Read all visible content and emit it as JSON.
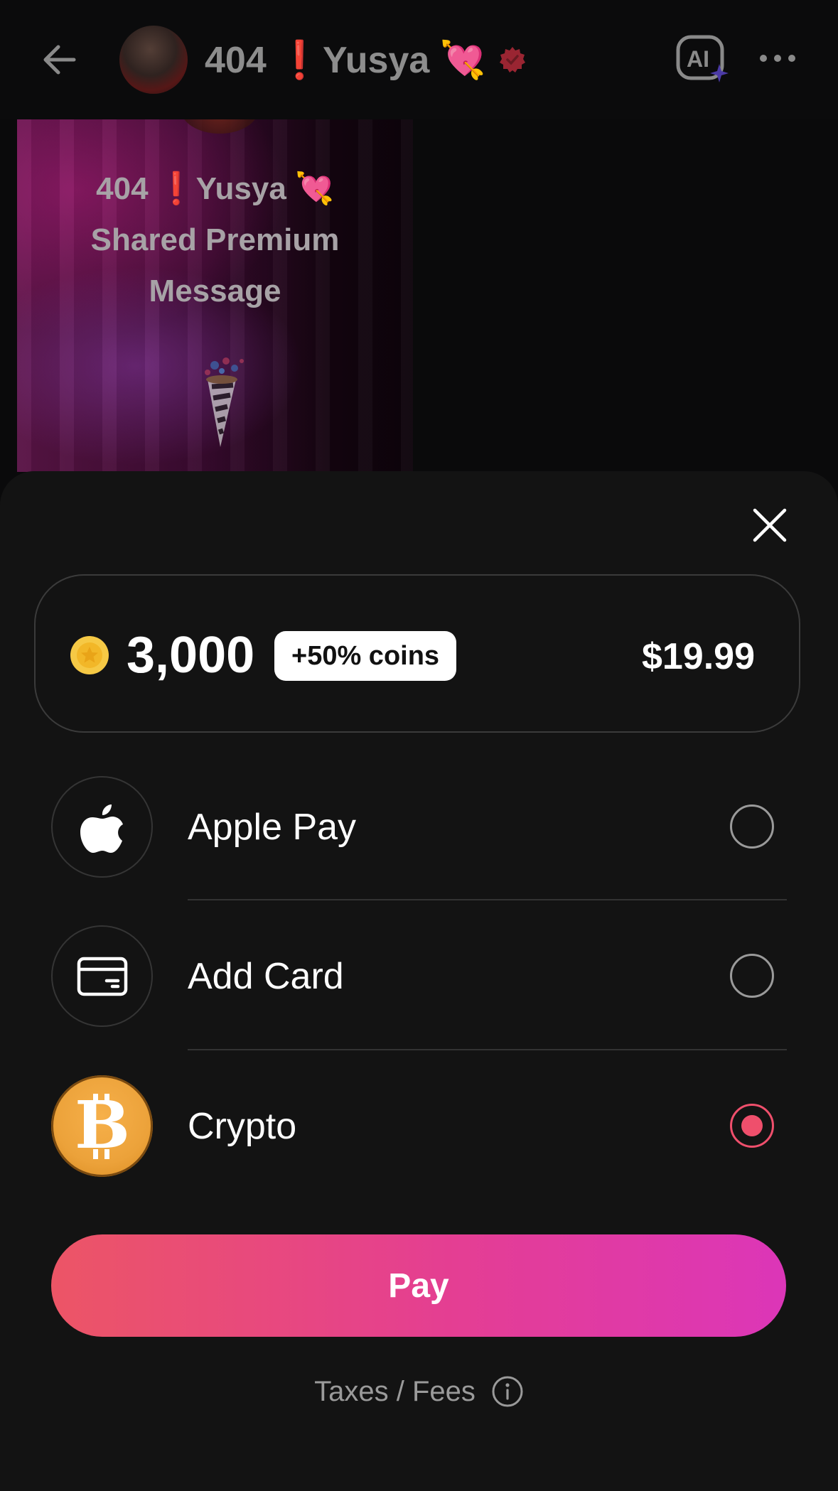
{
  "header": {
    "title": "404 ❗️Yusya 💘",
    "back_icon": "arrow-left-icon",
    "ai_icon": "ai-sparkle-icon",
    "more_icon": "more-horizontal-icon"
  },
  "premium_card": {
    "text": "404 ❗️Yusya 💘 Shared Premium Message",
    "decoration_icon": "party-popper-icon"
  },
  "sheet": {
    "close_icon": "close-icon",
    "offer": {
      "coin_amount": "3,000",
      "bonus": "+50% coins",
      "price": "$19.99"
    },
    "payment_options": [
      {
        "label": "Apple Pay",
        "icon": "apple-icon",
        "selected": false
      },
      {
        "label": "Add Card",
        "icon": "credit-card-icon",
        "selected": false
      },
      {
        "label": "Crypto",
        "icon": "bitcoin-icon",
        "selected": true
      }
    ],
    "pay_label": "Pay",
    "taxes_label": "Taxes / Fees"
  },
  "colors": {
    "accent": "#ef4f6c",
    "pay_gradient_start": "#ec5566",
    "pay_gradient_end": "#dc36b8",
    "bitcoin": "#eca23a",
    "coin": "#f6c945"
  }
}
